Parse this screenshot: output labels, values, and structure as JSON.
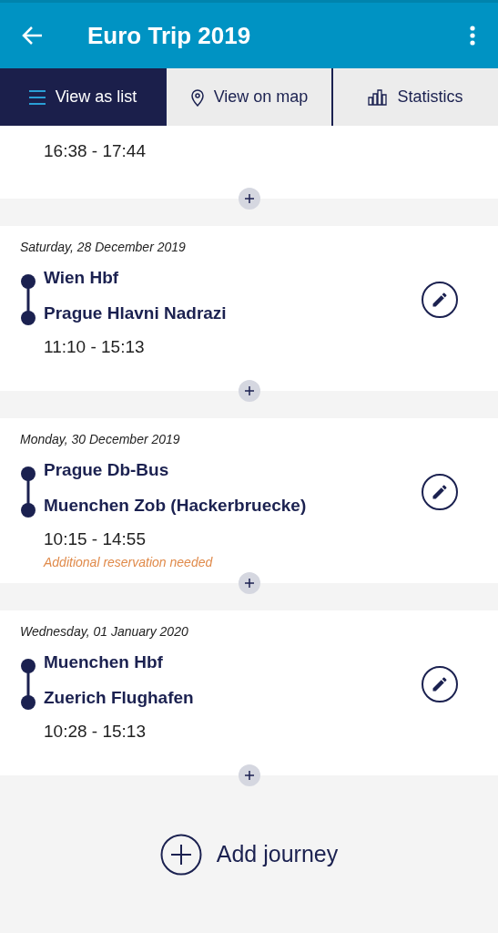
{
  "app_bar": {
    "title": "Euro Trip 2019"
  },
  "tabs": [
    {
      "label": "View as list",
      "kind": "list",
      "selected": true
    },
    {
      "label": "View on map",
      "kind": "map",
      "selected": false
    },
    {
      "label": "Statistics",
      "kind": "stats",
      "selected": false
    }
  ],
  "journeys": [
    {
      "time": "16:38 - 17:44",
      "kind": "partial"
    },
    {
      "kind": "full",
      "date": "Saturday, 28 December 2019",
      "from": "Wien Hbf",
      "to": "Prague Hlavni Nadrazi",
      "time": "11:10 - 15:13"
    },
    {
      "kind": "full",
      "date": "Monday, 30 December 2019",
      "from": "Prague Db-Bus",
      "to": "Muenchen Zob (Hackerbruecke)",
      "time": "10:15 - 14:55",
      "note": "Additional reservation needed"
    },
    {
      "kind": "full",
      "date": "Wednesday, 01 January 2020",
      "from": "Muenchen Hbf",
      "to": "Zuerich Flughafen",
      "time": "10:28 - 15:13"
    }
  ],
  "add_button": {
    "label": "Add journey"
  }
}
